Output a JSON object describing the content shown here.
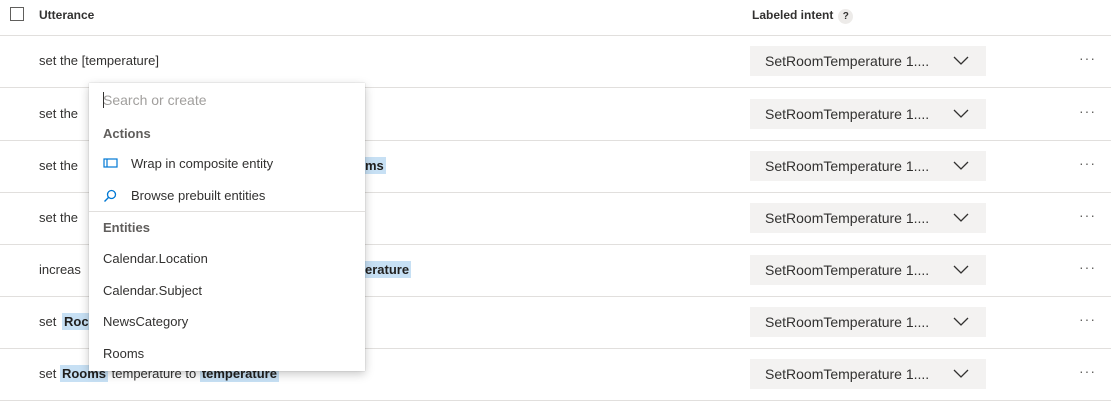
{
  "header": {
    "utterance_label": "Utterance",
    "intent_label": "Labeled intent",
    "help_glyph": "?"
  },
  "rows": [
    {
      "utterance_plain": "set the [temperature]",
      "intent": "SetRoomTemperature 1...."
    },
    {
      "utterance_plain": "set the",
      "intent": "SetRoomTemperature 1...."
    },
    {
      "utterance_plain": "set the",
      "visible_entity": "ms",
      "intent": "SetRoomTemperature 1...."
    },
    {
      "utterance_plain": "set the",
      "intent": "SetRoomTemperature 1...."
    },
    {
      "utterance_plain": "increas",
      "visible_entity": "erature",
      "intent": "SetRoomTemperature 1...."
    },
    {
      "utterance_plain": "set",
      "visible_entity": "Roc",
      "intent": "SetRoomTemperature 1...."
    },
    {
      "parts": [
        {
          "text": "set ",
          "entity": false
        },
        {
          "text": "Rooms",
          "entity": true
        },
        {
          "text": " temperature to ",
          "entity": false
        },
        {
          "text": "temperature",
          "entity": true
        }
      ],
      "intent": "SetRoomTemperature 1...."
    }
  ],
  "more_glyph": "···",
  "dropdown": {
    "search_placeholder": "Search or create",
    "actions_heading": "Actions",
    "actions": [
      {
        "label": "Wrap in composite entity",
        "icon": "composite-entity-icon"
      },
      {
        "label": "Browse prebuilt entities",
        "icon": "search-icon"
      }
    ],
    "entities_heading": "Entities",
    "entities": [
      "Calendar.Location",
      "Calendar.Subject",
      "NewsCategory",
      "Rooms"
    ]
  },
  "colors": {
    "entity_highlight": "#c7e0f4",
    "accent": "#0078d4",
    "intent_bg": "#f3f2f1"
  }
}
